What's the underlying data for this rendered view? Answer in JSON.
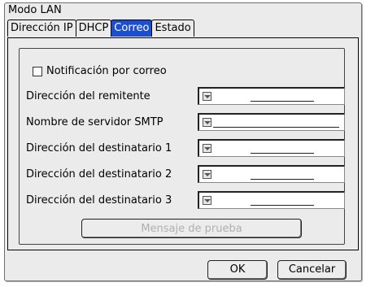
{
  "window": {
    "title": "Modo LAN"
  },
  "tabs": [
    {
      "label": "Dirección IP"
    },
    {
      "label": "DHCP"
    },
    {
      "label": "Correo"
    },
    {
      "label": "Estado"
    }
  ],
  "active_tab": "Correo",
  "notification": {
    "label": "Notificación por correo",
    "checked": false
  },
  "fields": {
    "sender": {
      "label": "Dirección del remitente",
      "value": ""
    },
    "smtp": {
      "label": "Nombre de servidor SMTP",
      "value": ""
    },
    "recipient1": {
      "label": "Dirección del destinatario 1",
      "value": ""
    },
    "recipient2": {
      "label": "Dirección del destinatario 2",
      "value": ""
    },
    "recipient3": {
      "label": "Dirección del destinatario 3",
      "value": ""
    }
  },
  "test_button": {
    "label": "Mensaje de prueba",
    "enabled": false
  },
  "footer": {
    "ok_label": "OK",
    "cancel_label": "Cancelar"
  },
  "colors": {
    "active_tab_bg": "#1c4fd0",
    "panel_bg": "#ebebeb",
    "disabled_text": "#b0b0b0"
  },
  "icons": {
    "dropdown": "chevron-down-icon"
  }
}
